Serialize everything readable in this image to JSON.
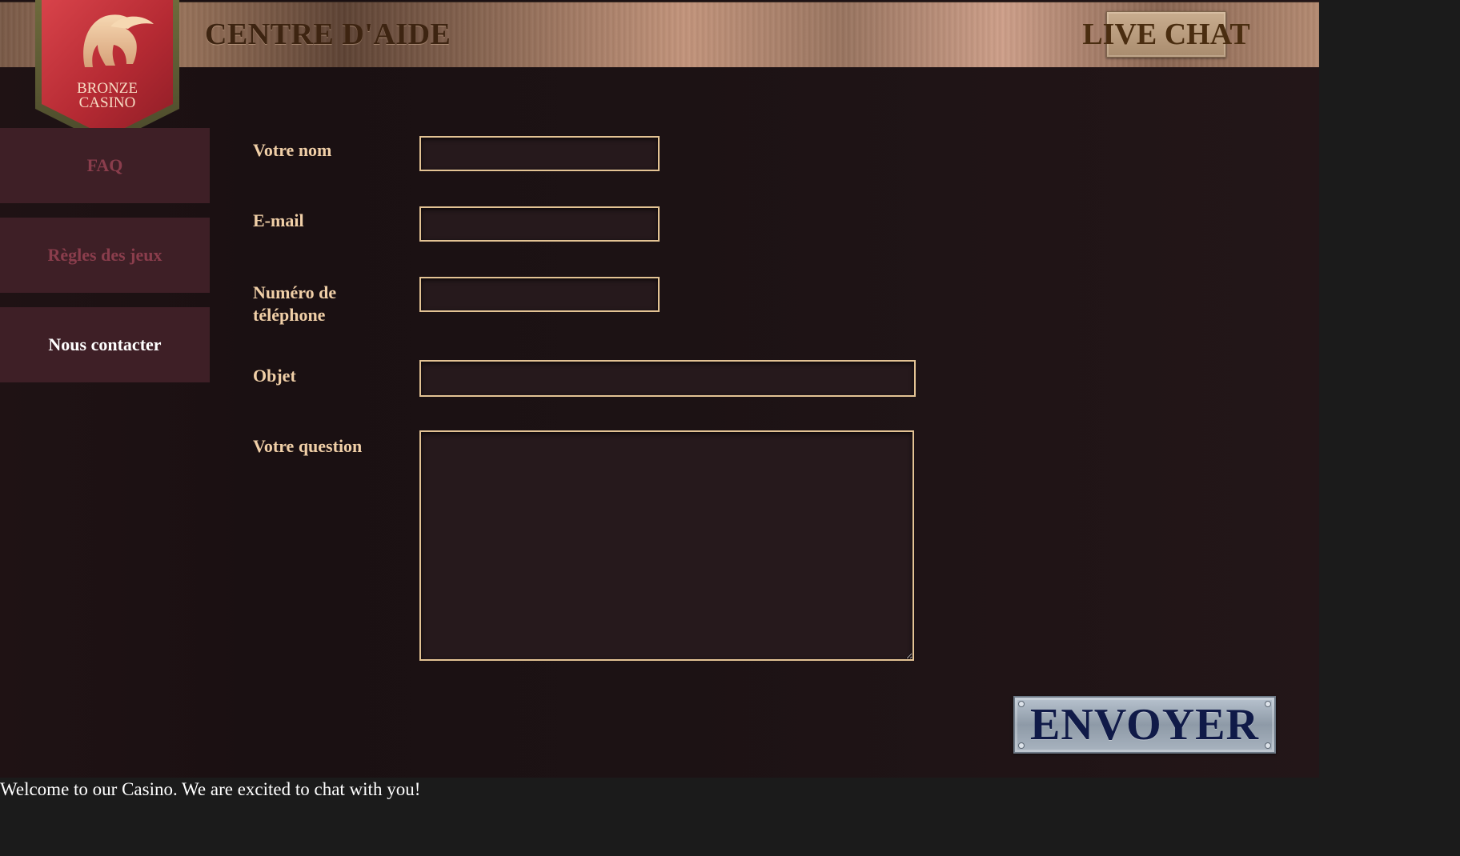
{
  "header": {
    "title": "CENTRE D'AIDE",
    "live_chat_label": "LIVE CHAT"
  },
  "logo": {
    "line1": "BRONZE",
    "line2": "CASINO",
    "icon": "spartan-helmet-icon"
  },
  "sidebar": {
    "items": [
      {
        "label": "FAQ",
        "active": false
      },
      {
        "label": "Règles des jeux",
        "active": false
      },
      {
        "label": "Nous contacter",
        "active": true
      }
    ]
  },
  "form": {
    "name_label": "Votre nom",
    "email_label": "E-mail",
    "phone_label": "Numéro de téléphone",
    "subject_label": "Objet",
    "question_label": "Votre question",
    "name_value": "",
    "email_value": "",
    "phone_value": "",
    "subject_value": "",
    "question_value": "",
    "submit_label": "ENVOYER"
  },
  "chat": {
    "welcome_message": "Welcome to our Casino. We are excited to chat with you!"
  },
  "colors": {
    "label_gold": "#f0cfa7",
    "field_border": "#e3c394",
    "sidebar_bg": "#3e1f26",
    "inactive_text": "#8a3d4c",
    "button_text": "#101a48"
  }
}
